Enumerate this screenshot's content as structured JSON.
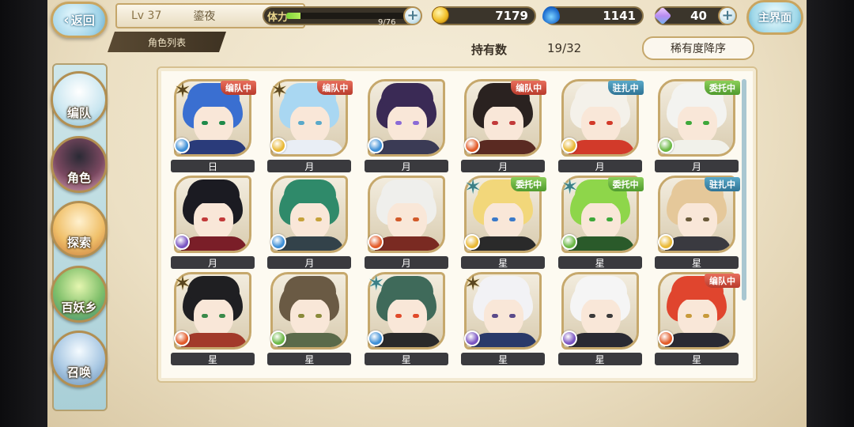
{
  "header": {
    "back_label": "返回",
    "level": "Lv 37",
    "player_name": "鎏夜",
    "tab_label": "角色列表",
    "stamina_label": "体力",
    "stamina_text": "9/76",
    "stamina_fill": 0.12,
    "coins": "7179",
    "souls": "1141",
    "gems": "40",
    "main_menu_label": "主界面"
  },
  "roster_header": {
    "holdings_label": "持有数",
    "holdings_value": "19/32",
    "sort_label": "稀有度降序"
  },
  "nav": [
    {
      "label": "编队",
      "icon": "formation-icon"
    },
    {
      "label": "角色",
      "icon": "character-icon"
    },
    {
      "label": "探索",
      "icon": "explore-icon"
    },
    {
      "label": "百妖乡",
      "icon": "village-icon"
    },
    {
      "label": "召唤",
      "icon": "summon-icon"
    }
  ],
  "colors": {
    "badge_formation": "#c24a3a",
    "badge_station": "#3a84a8",
    "badge_delegate": "#5ea63a",
    "rank_bar": "#3a3a3e"
  },
  "characters": [
    {
      "rank": "日",
      "status": "编队中",
      "status_kind": "red",
      "star": "gold",
      "element": "water"
    },
    {
      "rank": "月",
      "status": "编队中",
      "status_kind": "red",
      "star": "gold",
      "element": "light"
    },
    {
      "rank": "月",
      "status": "",
      "status_kind": "",
      "star": "",
      "element": "water"
    },
    {
      "rank": "月",
      "status": "编队中",
      "status_kind": "red",
      "star": "",
      "element": "fire"
    },
    {
      "rank": "月",
      "status": "驻扎中",
      "status_kind": "blue",
      "star": "",
      "element": "light"
    },
    {
      "rank": "月",
      "status": "委托中",
      "status_kind": "green",
      "star": "",
      "element": "wind"
    },
    {
      "rank": "月",
      "status": "",
      "status_kind": "",
      "star": "",
      "element": "dark"
    },
    {
      "rank": "月",
      "status": "",
      "status_kind": "",
      "star": "",
      "element": "water"
    },
    {
      "rank": "月",
      "status": "",
      "status_kind": "",
      "star": "",
      "element": "fire"
    },
    {
      "rank": "星",
      "status": "委托中",
      "status_kind": "green",
      "star": "blue",
      "element": "light"
    },
    {
      "rank": "星",
      "status": "委托中",
      "status_kind": "green",
      "star": "blue",
      "element": "wind"
    },
    {
      "rank": "星",
      "status": "驻扎中",
      "status_kind": "blue",
      "star": "",
      "element": "light"
    },
    {
      "rank": "星",
      "status": "",
      "status_kind": "",
      "star": "gold",
      "element": "fire"
    },
    {
      "rank": "星",
      "status": "",
      "status_kind": "",
      "star": "",
      "element": "wind"
    },
    {
      "rank": "星",
      "status": "",
      "status_kind": "",
      "star": "blue",
      "element": "water"
    },
    {
      "rank": "星",
      "status": "",
      "status_kind": "",
      "star": "gold",
      "element": "dark"
    },
    {
      "rank": "星",
      "status": "",
      "status_kind": "",
      "star": "",
      "element": "dark"
    },
    {
      "rank": "星",
      "status": "编队中",
      "status_kind": "red",
      "star": "",
      "element": "fire"
    }
  ]
}
